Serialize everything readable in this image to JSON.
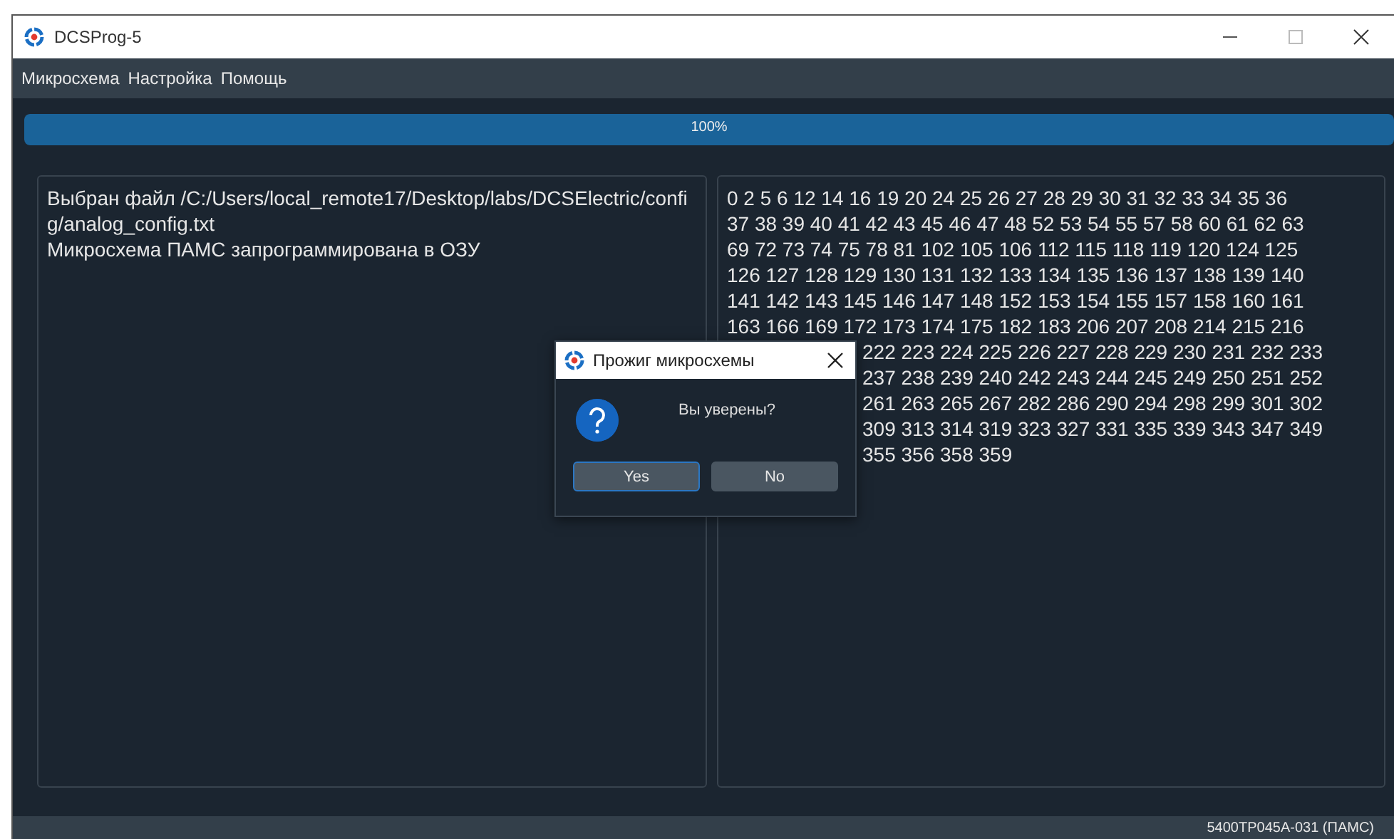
{
  "window": {
    "title": "DCSProg-5"
  },
  "menu": [
    "Микросхема",
    "Настройка",
    "Помощь"
  ],
  "progress": {
    "level": 1,
    "label": "100%"
  },
  "log": [
    "Выбран файл /C:/Users/local_remote17/Desktop/labs/DCSElectric/config/analog_config.txt",
    "Микросхема ПАМС запрограммирована в ОЗУ"
  ],
  "addresses": [
    {
      "kind": "full",
      "text": "0 2 5 6 12 14 16 19 20 24 25 26 27 28 29 30 31 32 33 34 35 36"
    },
    {
      "kind": "full",
      "text": "37 38 39 40 41 42 43 45 46 47 48 52 53 54 55 57 58 60 61 62 63"
    },
    {
      "kind": "full",
      "text": "69 72 73 74 75 78 81 102 105 106 112 115 118 119 120 124 125"
    },
    {
      "kind": "full",
      "text": "126 127 128 129 130 131 132 133 134 135 136 137 138 139 140"
    },
    {
      "kind": "full",
      "text": "141 142 143 145 146 147 148 152 153 154 155 157 158 160 161"
    },
    {
      "kind": "full",
      "text": "163 166 169 172 173 174 175 182 183 206 207 208 214 215 216"
    },
    {
      "kind": "covered",
      "text": "222 223 224 225 226 227 228 229 230 231 232 233"
    },
    {
      "kind": "covered",
      "text": "237 238 239 240 242 243 244 245 249 250 251 252"
    },
    {
      "kind": "covered",
      "text": "261 263 265 267 282 286 290 294 298 299 301 302"
    },
    {
      "kind": "covered",
      "text": "309 313 314 319 323 327 331 335 339 343 347 349"
    },
    {
      "kind": "covered",
      "text": "355 356 358 359"
    }
  ],
  "status_bar": "5400TP045A-031 (ПАМС)",
  "dialog": {
    "title": "Прожиг микросхемы",
    "message": "Вы уверены?",
    "buttons": [
      {
        "label": "Yes",
        "selected": true
      },
      {
        "label": "No",
        "selected": false
      }
    ]
  }
}
